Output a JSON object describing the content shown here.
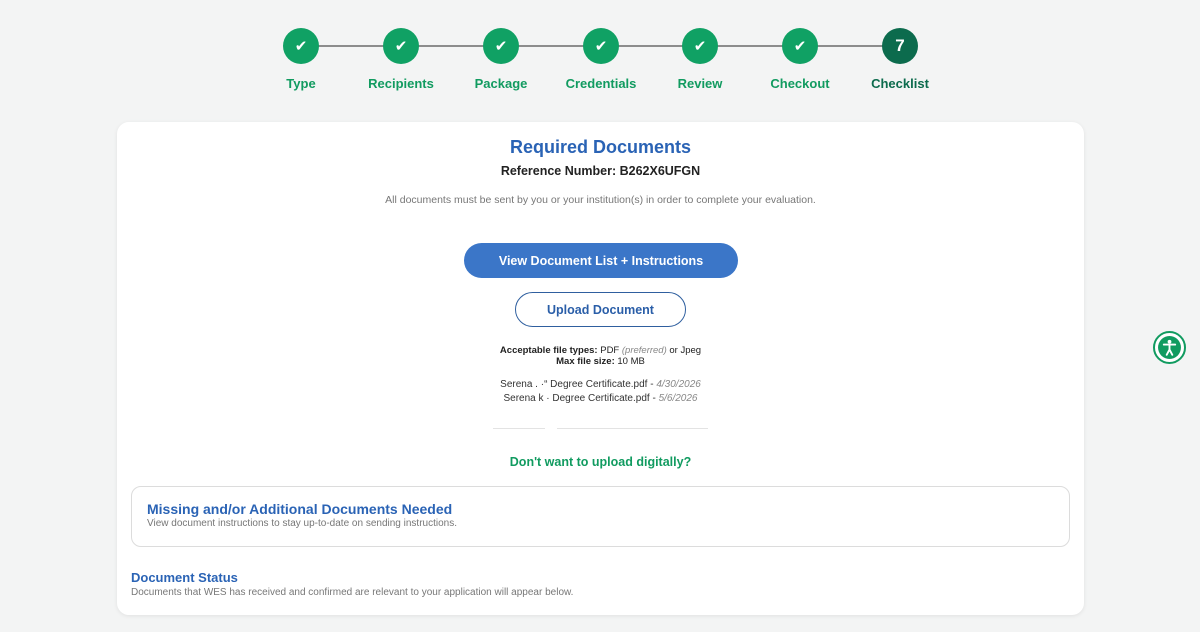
{
  "stepper": {
    "steps": [
      {
        "label": "Type",
        "marker": "✔"
      },
      {
        "label": "Recipients",
        "marker": "✔"
      },
      {
        "label": "Package",
        "marker": "✔"
      },
      {
        "label": "Credentials",
        "marker": "✔"
      },
      {
        "label": "Review",
        "marker": "✔"
      },
      {
        "label": "Checkout",
        "marker": "✔"
      },
      {
        "label": "Checklist",
        "marker": "7"
      }
    ]
  },
  "card": {
    "title": "Required Documents",
    "reference": "Reference Number: B262X6UFGN",
    "subtext": "All documents must be sent by you or your institution(s) in order to complete your evaluation.",
    "view_button": "View Document List + Instructions",
    "upload_button": "Upload Document",
    "file_types_label": "Acceptable file types:",
    "file_types_value": "PDF",
    "file_types_preferred": "(preferred)",
    "file_types_alt": "or Jpeg",
    "max_size_label": "Max file size:",
    "max_size_value": "10 MB",
    "uploaded_files": [
      {
        "name": "Serena . ·“   Degree Certificate.pdf -",
        "date": "4/30/2026"
      },
      {
        "name": "Serena k      · Degree Certificate.pdf -",
        "date": "5/6/2026"
      }
    ],
    "no_upload_link": "Don't want to upload digitally?",
    "missing_title": "Missing and/or Additional Documents Needed",
    "missing_sub": "View document instructions to stay up-to-date on sending instructions.",
    "status_title": "Document Status",
    "status_sub": "Documents that WES has received and confirmed are relevant to your application will appear below."
  },
  "colors": {
    "step_complete": "#10a164",
    "step_active": "#0c6b4d",
    "primary_blue": "#3b76c8",
    "heading_blue": "#2a63b5",
    "link_green": "#119b60"
  },
  "icons": {
    "accessibility": "accessibility-icon",
    "complete": "checkmark-icon"
  }
}
